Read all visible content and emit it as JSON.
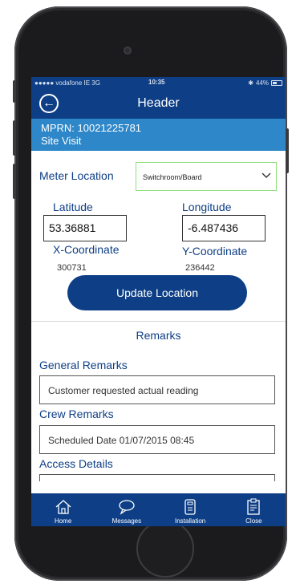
{
  "status_bar": {
    "carrier": "●●●●● vodafone IE  3G",
    "time": "10:35",
    "battery": "44%",
    "bluetooth_icon": "bluetooth-icon",
    "battery_icon": "battery-icon"
  },
  "header": {
    "title": "Header",
    "back_icon": "back-arrow-icon"
  },
  "info": {
    "mprn": "MPRN: 10021225781",
    "subtitle": "Site Visit"
  },
  "meter_location": {
    "label": "Meter Location",
    "selected": "Switchroom/Board",
    "chevron_icon": "chevron-down-icon"
  },
  "coordinates": {
    "latitude_label": "Latitude",
    "latitude_value": "53.36881",
    "longitude_label": "Longitude",
    "longitude_value": "-6.487436",
    "x_label": "X-Coordinate",
    "x_value": "300731",
    "y_label": "Y-Coordinate",
    "y_value": "236442"
  },
  "update_button": {
    "label": "Update Location"
  },
  "remarks": {
    "title": "Remarks",
    "general_label": "General Remarks",
    "general_value": "Customer requested actual reading",
    "crew_label": "Crew Remarks",
    "crew_value": "Scheduled Date 01/07/2015 08:45",
    "access_label": "Access Details",
    "access_value": ""
  },
  "tabs": [
    {
      "label": "Home",
      "icon": "home-icon"
    },
    {
      "label": "Messages",
      "icon": "messages-icon"
    },
    {
      "label": "Installation",
      "icon": "installation-icon"
    },
    {
      "label": "Close",
      "icon": "close-clipboard-icon"
    }
  ],
  "colors": {
    "primary_navy": "#0e3f86",
    "info_blue": "#2d87c8",
    "select_border_green": "#8fe07b"
  }
}
